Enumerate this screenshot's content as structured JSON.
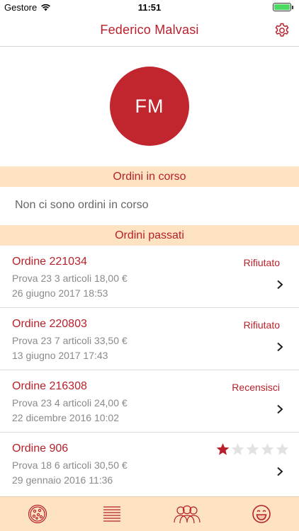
{
  "status_bar": {
    "carrier": "Gestore",
    "time": "11:51",
    "battery_level": 1.0
  },
  "nav": {
    "title": "Federico Malvasi",
    "settings_icon": "gear-icon"
  },
  "profile": {
    "initials": "FM"
  },
  "current_orders": {
    "header": "Ordini in corso",
    "empty_text": "Non ci sono ordini in corso"
  },
  "past_orders": {
    "header": "Ordini passati",
    "items": [
      {
        "title": "Ordine 221034",
        "detail": "Prova 23 3 articoli 18,00 €",
        "date": "26 giugno 2017 18:53",
        "status": "Rifiutato"
      },
      {
        "title": "Ordine 220803",
        "detail": "Prova 23 7 articoli 33,50 €",
        "date": "13 giugno 2017 17:43",
        "status": "Rifiutato"
      },
      {
        "title": "Ordine 216308",
        "detail": "Prova 23 4 articoli 24,00 €",
        "date": "22 dicembre 2016 10:02",
        "status": "Recensisci"
      },
      {
        "title": "Ordine 906",
        "detail": "Prova 18 6 articoli 30,50 €",
        "date": "29 gennaio 2016 11:36",
        "rating": 1,
        "rating_max": 5
      }
    ]
  },
  "tab_bar": {
    "tabs": [
      "pizza-icon",
      "menu-list-icon",
      "people-icon",
      "smiley-icon"
    ]
  },
  "colors": {
    "accent": "#b8212b",
    "avatar": "#c1262f",
    "section_bg": "#fde3c3",
    "battery": "#4cd964"
  }
}
